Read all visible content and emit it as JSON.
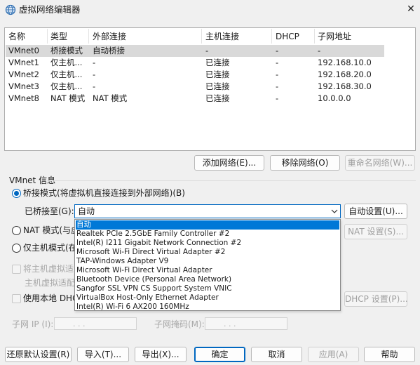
{
  "window": {
    "title": "虚拟网络编辑器",
    "close_glyph": "✕"
  },
  "table": {
    "headers": [
      "名称",
      "类型",
      "外部连接",
      "主机连接",
      "DHCP",
      "子网地址"
    ],
    "rows": [
      [
        "VMnet0",
        "桥接模式",
        "自动桥接",
        "-",
        "-",
        "-"
      ],
      [
        "VMnet1",
        "仅主机...",
        "-",
        "已连接",
        "-",
        "192.168.10.0"
      ],
      [
        "VMnet2",
        "仅主机...",
        "-",
        "已连接",
        "-",
        "192.168.20.0"
      ],
      [
        "VMnet3",
        "仅主机...",
        "-",
        "已连接",
        "-",
        "192.168.30.0"
      ],
      [
        "VMnet8",
        "NAT 模式",
        "NAT 模式",
        "已连接",
        "-",
        "10.0.0.0"
      ]
    ],
    "selected_row": 0
  },
  "net_buttons": {
    "add": "添加网络(E)...",
    "remove": "移除网络(O)",
    "rename": "重命名网络(W)..."
  },
  "vmnet_info": {
    "group_label": "VMnet 信息",
    "bridged_label": "桥接模式(将虚拟机直接连接到外部网络)(B)",
    "bridged_to_label": "已桥接至(G):",
    "bridged_to_value": "自动",
    "auto_settings": "自动设置(U)...",
    "nat_label": "NAT 模式(与虚",
    "nat_settings": "NAT 设置(S)...",
    "hostonly_label": "仅主机模式(在",
    "connect_host_label": "将主机虚拟适",
    "host_adapter_name": "主机虚拟适配",
    "use_dhcp_label": "使用本地 DHCP",
    "dhcp_settings": "DHCP 设置(P)...",
    "subnet_ip_label": "子网 IP (I):",
    "subnet_mask_label": "子网掩码(M):",
    "ip_dots": ". . ."
  },
  "dropdown_options": [
    "自动",
    "Realtek PCIe 2.5GbE Family Controller #2",
    "Intel(R) I211 Gigabit Network Connection #2",
    "Microsoft Wi-Fi Direct Virtual Adapter #2",
    "TAP-Windows Adapter V9",
    "Microsoft Wi-Fi Direct Virtual Adapter",
    "Bluetooth Device (Personal Area Network)",
    "Sangfor SSL VPN CS Support System VNIC",
    "VirtualBox Host-Only Ethernet Adapter",
    "Intel(R) Wi-Fi 6 AX200 160MHz"
  ],
  "highlighted_option": 0,
  "footer": {
    "restore": "还原默认设置(R)",
    "import": "导入(T)...",
    "export": "导出(X)...",
    "ok": "确定",
    "cancel": "取消",
    "apply": "应用(A)",
    "help": "帮助"
  },
  "colors": {
    "accent": "#0067c0",
    "highlight": "#0078d7",
    "selected_row": "#d9d9d9",
    "disabled_text": "#a0a0a0"
  },
  "icons": {
    "title": "network-globe-icon",
    "dropdown": "chevron-down-icon"
  }
}
